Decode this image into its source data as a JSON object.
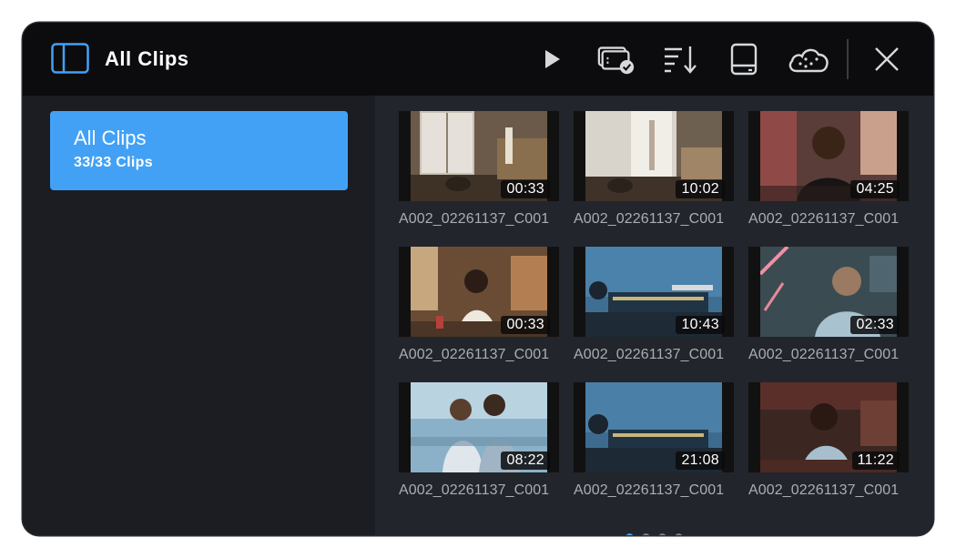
{
  "header": {
    "title": "All Clips"
  },
  "sidebar": {
    "items": [
      {
        "name": "All Clips",
        "count": "33/33 Clips"
      }
    ]
  },
  "clips": [
    {
      "name": "A002_02261137_C001",
      "duration": "00:33"
    },
    {
      "name": "A002_02261137_C001",
      "duration": "10:02"
    },
    {
      "name": "A002_02261137_C001",
      "duration": "04:25"
    },
    {
      "name": "A002_02261137_C001",
      "duration": "00:33"
    },
    {
      "name": "A002_02261137_C001",
      "duration": "10:43"
    },
    {
      "name": "A002_02261137_C001",
      "duration": "02:33"
    },
    {
      "name": "A002_02261137_C001",
      "duration": "08:22"
    },
    {
      "name": "A002_02261137_C001",
      "duration": "21:08"
    },
    {
      "name": "A002_02261137_C001",
      "duration": "11:22"
    }
  ],
  "pagination": {
    "pages": 4,
    "current": 1
  },
  "colors": {
    "accent": "#42a1f5",
    "background": "#1b1d22",
    "topbar": "#0c0c0e"
  },
  "icons": [
    "sidebar-toggle-icon",
    "play-icon",
    "media-card-check-icon",
    "sort-icon",
    "storage-drive-icon",
    "cloud-icon",
    "close-icon"
  ]
}
